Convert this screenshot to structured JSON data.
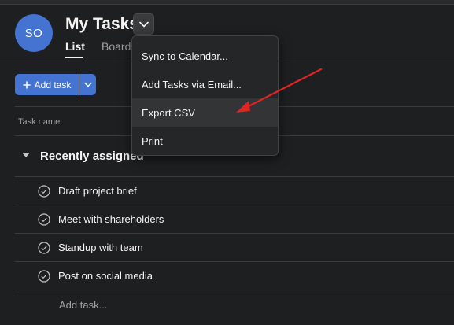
{
  "header": {
    "avatar_initials": "SO",
    "title": "My Tasks",
    "tabs": [
      {
        "label": "List",
        "active": true
      },
      {
        "label": "Board",
        "active": false
      }
    ]
  },
  "toolbar": {
    "add_task_label": "Add task",
    "add_task_icon": "plus-icon",
    "dropdown_icon": "chevron-down-icon"
  },
  "table": {
    "column_header": "Task name"
  },
  "section": {
    "title": "Recently assigned",
    "tasks": [
      {
        "label": "Draft project brief"
      },
      {
        "label": "Meet with shareholders"
      },
      {
        "label": "Standup with team"
      },
      {
        "label": "Post on social media"
      }
    ],
    "add_task_placeholder": "Add task..."
  },
  "menu": {
    "items": [
      {
        "label": "Sync to Calendar..."
      },
      {
        "label": "Add Tasks via Email..."
      },
      {
        "label": "Export CSV",
        "highlighted": true
      },
      {
        "label": "Print"
      }
    ]
  },
  "annotation": {
    "arrow_color": "#e02424"
  },
  "colors": {
    "accent": "#4573d2",
    "background": "#1e1f21"
  }
}
